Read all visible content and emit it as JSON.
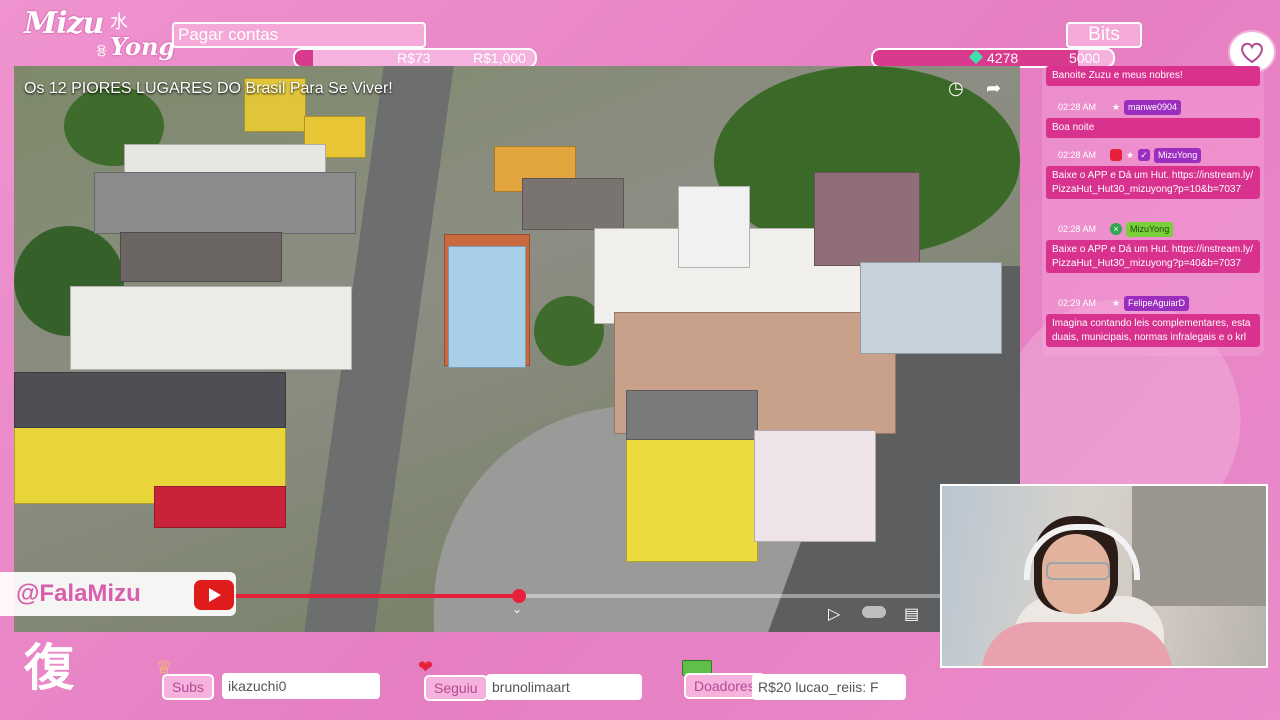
{
  "branding": {
    "logo_latin_1": "Mizu",
    "logo_latin_2": "Yong",
    "logo_kanji": "水",
    "logo_hangul": "용"
  },
  "goals": {
    "contas": {
      "label": "Pagar contas",
      "current": "R$73",
      "target": "R$1,000",
      "progress": 0.073
    },
    "bits": {
      "label": "Bits",
      "current": "4278",
      "target": "5000",
      "progress": 0.856
    }
  },
  "video": {
    "title": "Os 12 PIORES LUGARES DO Brasil Para Se Viver!",
    "progress": 0.37
  },
  "social": {
    "handle": "@FalaMizu"
  },
  "chat": {
    "messages": [
      {
        "time": "",
        "user": "",
        "text": "Banoite Zuzu e meus nobres!"
      },
      {
        "time": "02:28 AM",
        "user": "manwe0904",
        "text": "Boa noite"
      },
      {
        "time": "02:28 AM",
        "user": "MizuYong",
        "text": "Baixe o APP e Dá um Hut. https://instream.ly/PizzaHut_Hut30_mizuyong?p=10&b=7037"
      },
      {
        "time": "02:28 AM",
        "user": "MizuYong",
        "text": "Baixe o APP e Dá um Hut. https://instream.ly/PizzaHut_Hut30_mizuyong?p=40&b=7037"
      },
      {
        "time": "02:29 AM",
        "user": "FelipeAguiarD",
        "text": "Imagina contando leis complementares, estaduais, municipais, normas infralegais e o krl"
      }
    ]
  },
  "bottom": {
    "kanji": "復",
    "subs": {
      "label": "Subs",
      "value": "ikazuchi0"
    },
    "seguiu": {
      "label": "Seguiu",
      "value": "brunolimaart"
    },
    "doadores": {
      "label": "Doadores",
      "value": "R$20   lucao_reiis: F"
    }
  },
  "colors": {
    "accent": "#d93a8e",
    "background": "#e986c8",
    "username_bg": "#9b2dbf"
  }
}
